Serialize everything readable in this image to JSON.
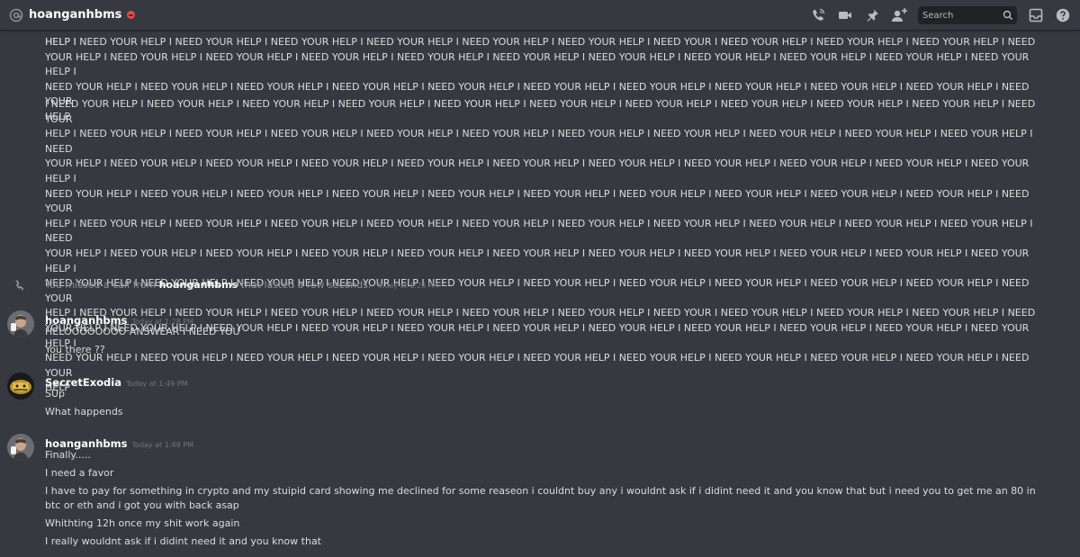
{
  "header": {
    "dm_name": "hoanganhbms",
    "search_placeholder": "Search",
    "icons": [
      "at-sign-icon",
      "dnd-status-icon",
      "start-voice-call-icon",
      "start-video-call-icon",
      "pinned-messages-icon",
      "add-friends-to-dm-icon",
      "search-icon",
      "inbox-icon",
      "help-icon"
    ]
  },
  "spam_block_1": [
    "HELP  I NEED YOUR HELP  I NEED YOUR HELP  I NEED YOUR HELP  I NEED YOUR HELP  I NEED YOUR HELP  I NEED YOUR HELP  I NEED YOUR   I NEED YOUR HELP  I NEED YOUR HELP  I NEED YOUR HELP  I NEED",
    "YOUR HELP  I NEED YOUR HELP  I NEED YOUR HELP  I NEED YOUR HELP  I NEED YOUR HELP  I NEED YOUR HELP  I NEED YOUR HELP  I NEED YOUR HELP  I NEED YOUR HELP  I NEED YOUR HELP  I NEED YOUR HELP  I",
    "NEED YOUR HELP  I NEED YOUR HELP  I NEED YOUR HELP  I NEED YOUR HELP  I NEED YOUR HELP  I NEED YOUR HELP  I NEED YOUR HELP  I NEED YOUR HELP  I NEED YOUR HELP  I NEED YOUR HELP  I NEED YOUR",
    "HELP"
  ],
  "spam_block_2": [
    "I NEED YOUR HELP  I NEED YOUR HELP  I NEED YOUR HELP  I NEED YOUR HELP  I NEED YOUR HELP  I NEED YOUR HELP  I NEED YOUR HELP  I NEED YOUR HELP  I NEED YOUR HELP  I NEED YOUR HELP  I NEED YOUR",
    "HELP  I NEED YOUR HELP  I NEED YOUR HELP  I NEED YOUR HELP  I NEED YOUR HELP  I NEED YOUR HELP  I NEED YOUR HELP  I NEED YOUR HELP  I NEED YOUR HELP  I NEED YOUR HELP  I NEED YOUR HELP  I NEED",
    "YOUR HELP  I NEED YOUR HELP  I NEED YOUR HELP  I NEED YOUR HELP  I NEED YOUR HELP  I NEED YOUR HELP  I NEED YOUR HELP  I NEED YOUR HELP  I NEED YOUR HELP  I NEED YOUR HELP  I NEED YOUR HELP  I",
    "NEED YOUR HELP  I NEED YOUR HELP  I NEED YOUR HELP  I NEED YOUR HELP  I NEED YOUR HELP  I NEED YOUR HELP  I NEED YOUR HELP  I NEED YOUR HELP  I NEED YOUR HELP  I NEED YOUR HELP  I NEED YOUR",
    "HELP  I NEED YOUR HELP  I NEED YOUR HELP  I NEED YOUR HELP  I NEED YOUR HELP  I NEED YOUR HELP  I NEED YOUR HELP  I NEED YOUR HELP  I NEED YOUR HELP  I NEED YOUR HELP  I NEED YOUR HELP  I NEED",
    "YOUR HELP  I NEED YOUR HELP  I NEED YOUR HELP  I NEED YOUR HELP  I NEED YOUR HELP  I NEED YOUR HELP  I NEED YOUR HELP  I NEED YOUR HELP  I NEED YOUR HELP  I NEED YOUR HELP  I NEED YOUR HELP  I",
    "NEED YOUR HELP  I NEED YOUR HELP  I NEED YOUR HELP  I NEED YOUR HELP  I NEED YOUR HELP  I NEED YOUR HELP  I NEED YOUR HELP  I NEED YOUR HELP  I NEED YOUR HELP  I NEED YOUR HELP  I NEED YOUR",
    "HELP  I NEED YOUR HELP  I NEED YOUR HELP  I NEED YOUR HELP  I NEED YOUR HELP  I NEED YOUR HELP  I NEED YOUR HELP  I NEED YOUR   I NEED YOUR HELP  I NEED YOUR HELP  I NEED YOUR HELP  I NEED",
    "YOUR HELP  I NEED YOUR HELP  I NEED YOUR HELP  I NEED YOUR HELP  I NEED YOUR HELP  I NEED YOUR HELP  I NEED YOUR HELP  I NEED YOUR HELP  I NEED YOUR HELP  I NEED YOUR HELP  I NEED YOUR HELP  I",
    "NEED YOUR HELP  I NEED YOUR HELP  I NEED YOUR HELP  I NEED YOUR HELP  I NEED YOUR HELP  I NEED YOUR HELP  I NEED YOUR HELP  I NEED YOUR HELP  I NEED YOUR HELP  I NEED YOUR HELP  I NEED YOUR",
    "HELP"
  ],
  "system_message": {
    "prefix": "You missed a call from",
    "user": "hoanganhbms",
    "suffix": "that lasted a few seconds.",
    "timestamp": "Today at 1:28 PM"
  },
  "messages": [
    {
      "author": "hoanganhbms",
      "timestamp": "Today at 1:28 PM",
      "lines": [
        "HELOOOOOOOO ANSWEAR I NEED YOU",
        "You there ??"
      ]
    },
    {
      "author": "SecretExodia",
      "timestamp": "Today at 1:49 PM",
      "lines": [
        "SUp",
        "What happends"
      ]
    },
    {
      "author": "hoanganhbms",
      "timestamp": "Today at 1:49 PM",
      "lines": [
        "Finally.....",
        "I need a favor",
        "I have to pay for something in crypto and my stuipid card showing me declined for some reaseon i couldnt buy any i wouldnt ask if i didint need it and you know that but i need you to get me an 80 in btc or eth and i got you with back asap",
        "Whithting 12h once my shit work again",
        "I really wouldnt ask if i didint need it and you know that"
      ]
    }
  ],
  "colors": {
    "background": "#36393f",
    "header_text": "#ffffff",
    "muted_text": "#8e9297",
    "dnd_status": "#f04747"
  }
}
